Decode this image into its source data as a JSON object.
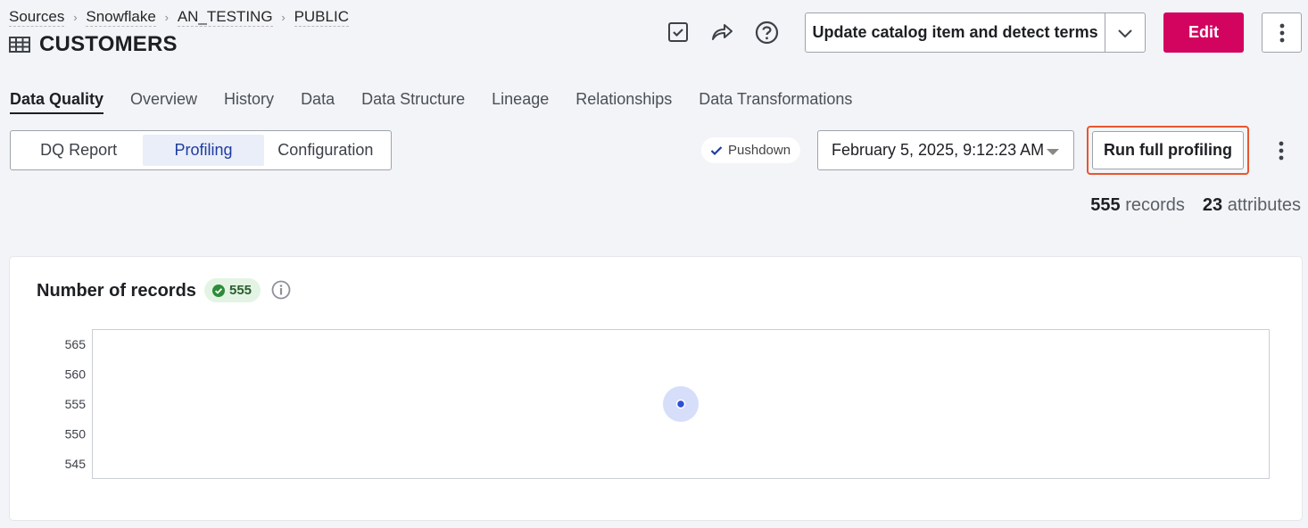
{
  "breadcrumb": [
    "Sources",
    "Snowflake",
    "AN_TESTING",
    "PUBLIC"
  ],
  "page": {
    "title": "CUSTOMERS",
    "icon": "table-icon"
  },
  "toolbar": {
    "icons": [
      "task-checkbox-icon",
      "share-arrow-icon",
      "help-circle-icon"
    ],
    "primary_action": "Update catalog item and detect terms",
    "edit_label": "Edit",
    "more_icon": "kebab-vertical-icon"
  },
  "main_tabs": [
    {
      "label": "Data Quality",
      "active": true
    },
    {
      "label": "Overview",
      "active": false
    },
    {
      "label": "History",
      "active": false
    },
    {
      "label": "Data",
      "active": false
    },
    {
      "label": "Data Structure",
      "active": false
    },
    {
      "label": "Lineage",
      "active": false
    },
    {
      "label": "Relationships",
      "active": false
    },
    {
      "label": "Data Transformations",
      "active": false
    }
  ],
  "sub_tabs": [
    {
      "label": "DQ Report",
      "active": false
    },
    {
      "label": "Profiling",
      "active": true
    },
    {
      "label": "Configuration",
      "active": false
    }
  ],
  "pushdown": {
    "label": "Pushdown",
    "checked": true
  },
  "date_select": {
    "value": "February 5, 2025, 9:12:23 AM"
  },
  "run_button": "Run full profiling",
  "stats": {
    "records_count": "555",
    "records_label": "records",
    "attributes_count": "23",
    "attributes_label": "attributes"
  },
  "records_card": {
    "title": "Number of records",
    "badge_value": "555",
    "badge_status": "ok"
  },
  "chart_data": {
    "type": "scatter",
    "title": "",
    "xlabel": "",
    "ylabel": "",
    "y_ticks": [
      565,
      560,
      555,
      550,
      545
    ],
    "ylim": [
      542.5,
      567.5
    ],
    "series": [
      {
        "values": [
          555
        ]
      }
    ],
    "grid": false,
    "colors": {
      "point": "#2d4fd6",
      "halo": "#d6defa"
    }
  }
}
